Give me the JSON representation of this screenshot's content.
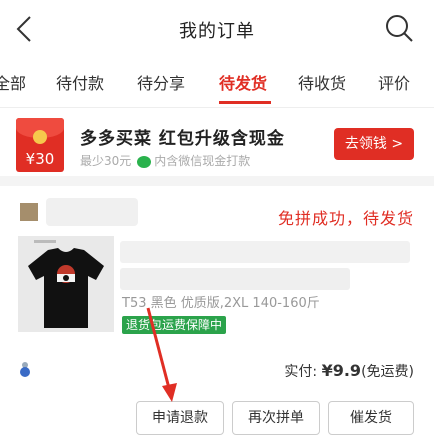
{
  "header": {
    "title": "我的订单"
  },
  "tabs": [
    {
      "label": "全部",
      "active": false
    },
    {
      "label": "待付款",
      "active": false
    },
    {
      "label": "待分享",
      "active": false
    },
    {
      "label": "待发货",
      "active": true
    },
    {
      "label": "待收货",
      "active": false
    },
    {
      "label": "评价",
      "active": false
    }
  ],
  "promo": {
    "amount": "¥30",
    "title": "多多买菜 红包升级含现金",
    "subtitle_left": "最少30元",
    "subtitle_right": "内含微信现金打款",
    "button_label": "去领钱 >"
  },
  "order": {
    "status": "免拼成功，待发货",
    "spec": "T53  黑色 优质版,2XL 140-160斤",
    "guarantee_badge": "退货包运费保障中",
    "total_label": "实付: ",
    "total_price": "¥9.9",
    "shipping_note": "(免运费)",
    "buttons": {
      "refund": "申请退款",
      "regroup": "再次拼单",
      "urge": "催发货"
    }
  },
  "colors": {
    "accent": "#e02e24",
    "green": "#2ba34b"
  }
}
